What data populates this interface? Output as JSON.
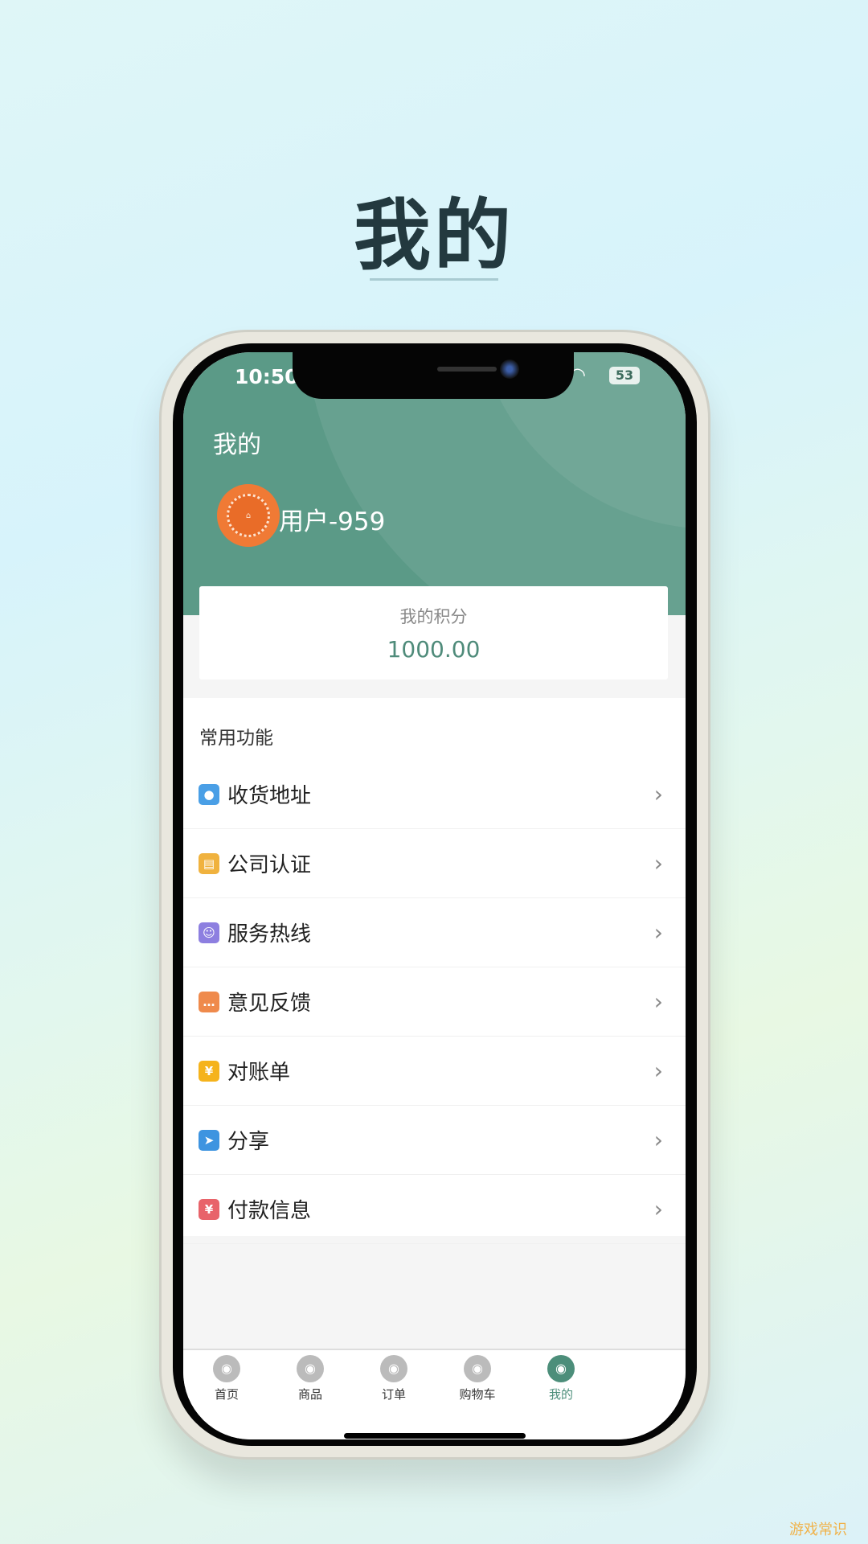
{
  "promo": {
    "title": "我的"
  },
  "status": {
    "time": "10:50",
    "battery": "53"
  },
  "header": {
    "title": "我的",
    "username": "用户-959"
  },
  "points": {
    "label": "我的积分",
    "value": "1000.00"
  },
  "section": {
    "title": "常用功能"
  },
  "menu": [
    {
      "label": "收货地址",
      "icon": "location-pin-icon",
      "color": "#4a9fe6"
    },
    {
      "label": "公司认证",
      "icon": "building-icon",
      "color": "#f0b23e"
    },
    {
      "label": "服务热线",
      "icon": "customer-service-icon",
      "color": "#8d7fe0"
    },
    {
      "label": "意见反馈",
      "icon": "chat-bubble-icon",
      "color": "#ef8a4c"
    },
    {
      "label": "对账单",
      "icon": "bill-yen-icon",
      "color": "#f5b31c"
    },
    {
      "label": "分享",
      "icon": "paper-plane-icon",
      "color": "#3e94e0"
    },
    {
      "label": "付款信息",
      "icon": "payment-yen-icon",
      "color": "#e8636a"
    }
  ],
  "tabs": [
    {
      "label": "首页",
      "icon": "shop-icon"
    },
    {
      "label": "商品",
      "icon": "goods-icon"
    },
    {
      "label": "订单",
      "icon": "ship-order-icon"
    },
    {
      "label": "购物车",
      "icon": "cart-icon"
    },
    {
      "label": "我的",
      "icon": "cat-profile-icon",
      "active": true
    }
  ],
  "accent": "#5b9a87",
  "watermark": "游戏常识"
}
